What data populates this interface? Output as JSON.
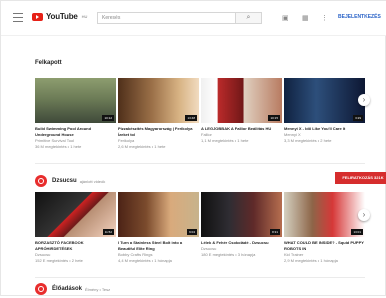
{
  "header": {
    "logo_text": "YouTube",
    "logo_sup": "HU",
    "search_placeholder": "Keresés",
    "signin": "BEJELENTKEZÉS"
  },
  "sections": [
    {
      "title": "Felkapott",
      "videos": [
        {
          "title": "Build Swimming Pool Around Underground House",
          "channel": "Primitive Survival Tool",
          "meta": "36 M megtekintés • 1 hete",
          "duration": "10:12"
        },
        {
          "title": "Pizzakészítés Magyarország | Ferikolya Ízeket tol",
          "channel": "Ferikolya",
          "meta": "2,6 M megtekintés • 1 hete",
          "duration": "13:48"
        },
        {
          "title": "A LEGJOBBAK A Fallior Beállítás HU",
          "channel": "Fallior",
          "meta": "1,1 M megtekintés • 1 hete",
          "duration": "10:15"
        },
        {
          "title": "Mennyi X - Idő Like You'll Care It",
          "channel": "Mennyi X",
          "meta": "3,3 M megtekintés • 2 hete",
          "duration": "3:29"
        }
      ]
    },
    {
      "title": "Dzsucsu",
      "note": "ajánlott videók",
      "subscribe": "FELIRATKOZÁS 321K",
      "videos": [
        {
          "title": "BORZASZTÓ FACEBOOK APRÓHIRDETÉSEK",
          "channel": "Dzsucsu",
          "meta": "152 E megtekintés • 2 hete",
          "duration": "11:52"
        },
        {
          "title": "I Turn a Stainless Steel Bolt into a Beautiful Elite Ring",
          "channel": "Bobby Crafts Rings",
          "meta": "4,4 M megtekintés • 1 hónapja",
          "duration": "9:04"
        },
        {
          "title": "Lélek & Fehér Csokoládé - Dzsucsu",
          "channel": "Dzsucsu",
          "meta": "180 E megtekintés • 3 hónapja",
          "duration": "8:31"
        },
        {
          "title": "WHAT COULD BE INSIDE? - Squid PUPPY ROBOTS IN",
          "channel": "Kid Trainer",
          "meta": "2,9 M megtekintés • 1 hónapja",
          "duration": "13:01"
        }
      ]
    },
    {
      "title": "Élőadások",
      "note": "Élmény • Tesz"
    }
  ]
}
